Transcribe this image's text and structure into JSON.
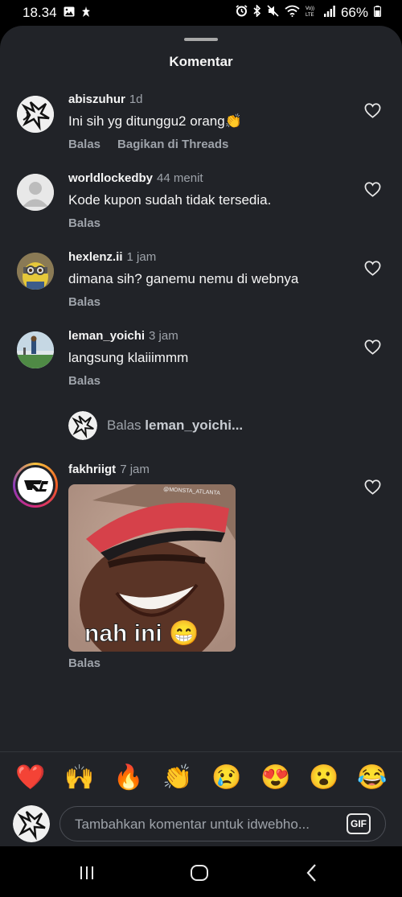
{
  "status_bar": {
    "time": "18.34",
    "battery": "66%",
    "left_icons": [
      "gallery-icon",
      "clean-icon"
    ],
    "right_icons": [
      "alarm-icon",
      "bluetooth-icon",
      "mute-icon",
      "wifi-icon",
      "volte-icon",
      "signal-icon",
      "battery-icon"
    ]
  },
  "sheet": {
    "title": "Komentar"
  },
  "comments": [
    {
      "username": "abiszuhur",
      "time": "1d",
      "text": "Ini sih yg ditunggu2 orang👏",
      "actions": [
        "Balas",
        "Bagikan di Threads"
      ]
    },
    {
      "username": "worldlockedby",
      "time": "44 menit",
      "text": "Kode kupon sudah tidak tersedia.",
      "actions": [
        "Balas"
      ]
    },
    {
      "username": "hexlenz.ii",
      "time": "1 jam",
      "text": "dimana sih? ganemu nemu di webnya",
      "actions": [
        "Balas"
      ]
    },
    {
      "username": "leman_yoichi",
      "time": "3 jam",
      "text": "langsung klaiiimmm",
      "actions": [
        "Balas"
      ]
    },
    {
      "username": "fakhriigt",
      "time": "7 jam",
      "text": "",
      "actions": [
        "Balas"
      ]
    }
  ],
  "reply_prompt": {
    "prefix": "Balas",
    "username": "leman_yoichi..."
  },
  "gif_post": {
    "caption": "nah ini 😁",
    "hat_text": "@MONSTA_ATLANTA"
  },
  "quick_reactions": [
    "❤️",
    "🙌",
    "🔥",
    "👏",
    "😢",
    "😍",
    "😮",
    "😂"
  ],
  "composer": {
    "placeholder": "Tambahkan komentar untuk idwebho...",
    "gif_label": "GIF"
  },
  "colors": {
    "sheet_bg": "#212328",
    "muted_text": "#9ea3aa",
    "background": "#000000"
  }
}
